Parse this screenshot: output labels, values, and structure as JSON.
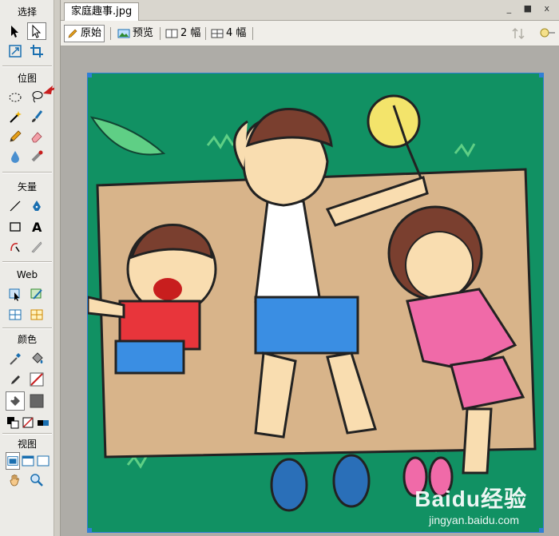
{
  "tools_panel": {
    "sections": [
      {
        "title": "选择"
      },
      {
        "title": "位图"
      },
      {
        "title": "矢量"
      },
      {
        "title": "Web"
      },
      {
        "title": "颜色"
      },
      {
        "title": "视图"
      }
    ]
  },
  "document": {
    "tab_title": "家庭趣事.jpg",
    "window_controls": "_ ■ x",
    "view_buttons": [
      {
        "label": "原始",
        "active": true
      },
      {
        "label": "预览",
        "active": false
      },
      {
        "label": "2 幅",
        "active": false
      },
      {
        "label": "4 幅",
        "active": false
      }
    ]
  },
  "watermark": {
    "logo": "Baidu经验",
    "url": "jingyan.baidu.com"
  },
  "colors": {
    "canvas_bg": "#119163",
    "selection": "#2f7fd6",
    "annotation_arrow": "#c81e1e",
    "stroke_swatch": "#c81e1e",
    "fill_swatch": "#666666"
  }
}
